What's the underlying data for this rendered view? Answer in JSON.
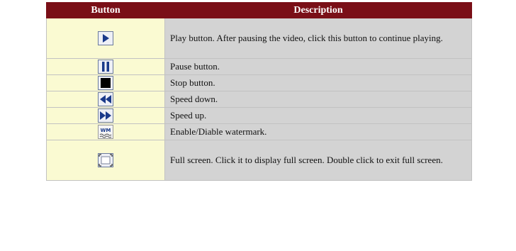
{
  "table": {
    "headers": {
      "button": "Button",
      "description": "Description"
    },
    "rows": [
      {
        "icon": "play-icon",
        "description": "Play button. After pausing the video, click this button to continue playing."
      },
      {
        "icon": "pause-icon",
        "description": "Pause button."
      },
      {
        "icon": "stop-icon",
        "description": "Stop button."
      },
      {
        "icon": "speed-down-icon",
        "description": "Speed down."
      },
      {
        "icon": "speed-up-icon",
        "description": "Speed up."
      },
      {
        "icon": "watermark-icon",
        "description": "Enable/Diable watermark."
      },
      {
        "icon": "fullscreen-icon",
        "description": "Full screen. Click it to display full screen. Double click to exit full screen."
      }
    ]
  },
  "colors": {
    "header_bg": "#7a0f17",
    "icon_cell_bg": "#fafad2",
    "desc_cell_bg": "#d3d3d3",
    "icon_color": "#1a3a8a"
  }
}
